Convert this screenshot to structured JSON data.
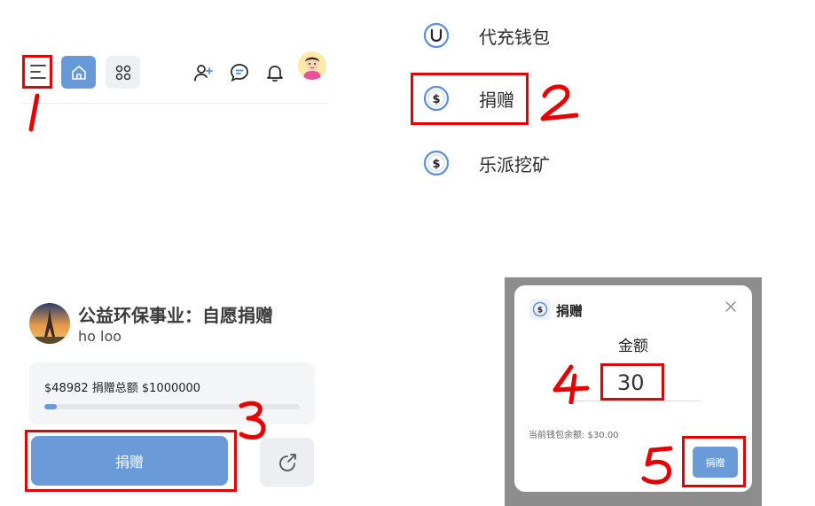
{
  "nav": {
    "menu_icon": "hamburger-menu-icon",
    "home_icon": "home-icon",
    "apps_icon": "apps-grid-icon",
    "add_user_icon": "add-user-icon",
    "chat_icon": "chat-bubble-icon",
    "bell_icon": "bell-icon",
    "avatar_icon": "user-avatar"
  },
  "wallet_menu": {
    "items": [
      {
        "label": "代充钱包",
        "icon": "wallet-power-icon"
      },
      {
        "label": "捐赠",
        "icon": "dollar-circle-icon"
      },
      {
        "label": "乐派挖矿",
        "icon": "dollar-circle-icon"
      }
    ]
  },
  "project": {
    "title": "公益环保事业：自愿捐赠",
    "author": "ho loo",
    "progress_text": "$48982 捐赠总额 $1000000",
    "progress_fraction": 0.049,
    "donate_button": "捐赠",
    "share_icon": "share-arrow-icon"
  },
  "modal": {
    "title": "捐赠",
    "amount_label": "金额",
    "amount_value": "30",
    "balance_text": "当前钱包余额: $30.00",
    "donate_button": "捐赠",
    "close_icon": "close-icon"
  },
  "annotations": {
    "steps": [
      "1",
      "2",
      "3",
      "4",
      "5"
    ],
    "color": "#e60000"
  },
  "colors": {
    "accent": "#6a9bd8",
    "highlight": "#e60000"
  }
}
